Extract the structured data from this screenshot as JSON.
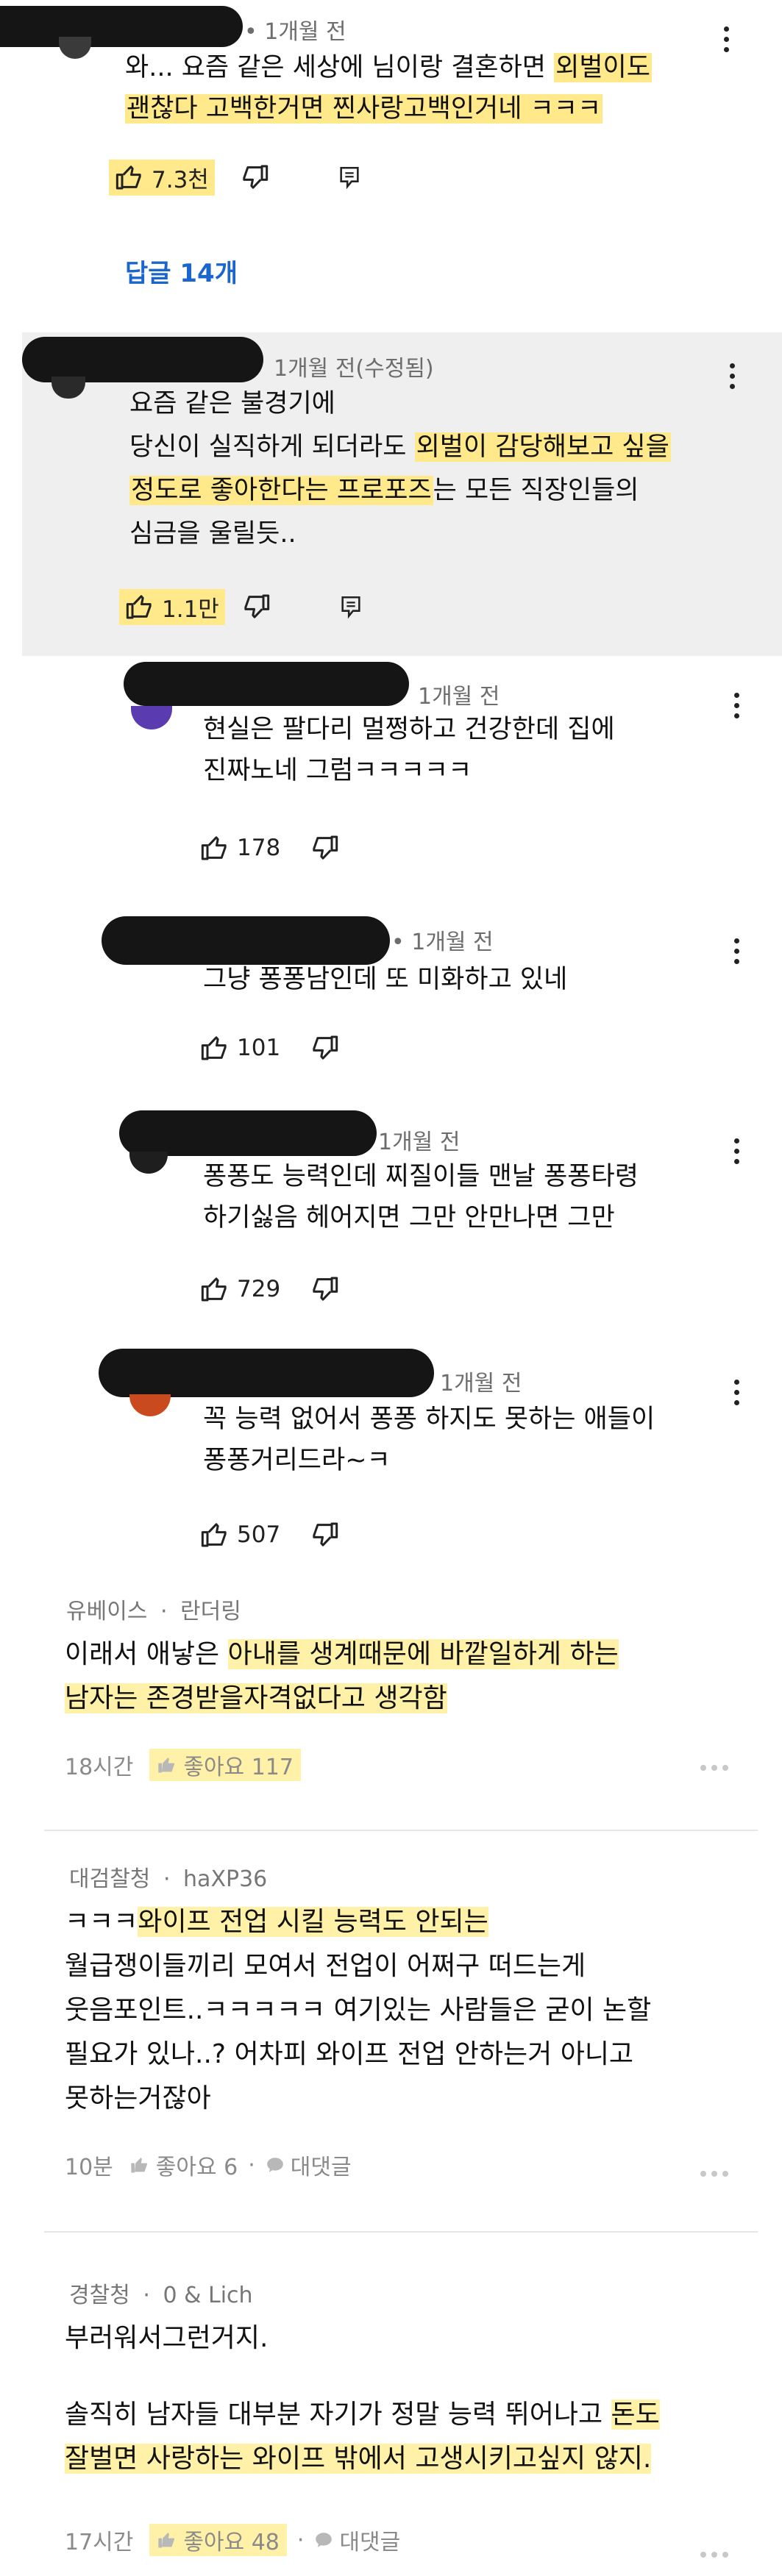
{
  "youtube": {
    "c1": {
      "time": "• 1개월 전",
      "line1_pre": "와... 요즘 같은 세상에 님이랑 결혼하면 ",
      "line1_hl": "외벌이도",
      "line2": "괜찮다 고백한거면 찐사랑고백인거네 ㅋㅋㅋ",
      "likes": "7.3천",
      "replies": "답글 14개"
    },
    "c2": {
      "time": "1개월 전(수정됨)",
      "line1": "요즘 같은 불경기에",
      "line2_pre": "당신이 실직하게 되더라도 ",
      "line2_hl": "외벌이 감당해보고 싶을",
      "line3_hl": "정도로 좋아한다는 프로포즈",
      "line3_post": "는 모든 직장인들의",
      "line4": "심금을 울릴듯..",
      "likes": "1.1만"
    },
    "r1": {
      "time": "1개월 전",
      "line1": "현실은 팔다리 멀쩡하고 건강한데 집에",
      "line2": "진짜노네 그럼ㅋㅋㅋㅋㅋ",
      "likes": "178"
    },
    "r2": {
      "time": "• 1개월 전",
      "line1": "그냥 퐁퐁남인데 또 미화하고 있네",
      "likes": "101"
    },
    "r3": {
      "time": "1개월 전",
      "line1": "퐁퐁도 능력인데 찌질이들 맨날 퐁퐁타령",
      "line2": "하기싫음 헤어지면 그만 안만나면 그만",
      "likes": "729"
    },
    "r4": {
      "time": "1개월 전",
      "line1": "꼭 능력 없어서 퐁퐁 하지도 못하는 애들이",
      "line2": "퐁퐁거리드라~ㅋ",
      "likes": "507"
    }
  },
  "naver": {
    "n1": {
      "company": "유베이스",
      "sep": "·",
      "nick": "란더링",
      "line1_pre": "이래서 애낳은 ",
      "line1_hl": "아내를 생계때문에 바깥일하게 하는",
      "line2_hl": "남자는 존경받을자격없다고 ",
      "line2_post": "생각함",
      "time": "18시간",
      "like": "좋아요 117"
    },
    "n2": {
      "company": "대검찰청",
      "sep": "·",
      "nick": "haXP36",
      "line1_pre": "ㅋㅋㅋ",
      "line1_hl": "와이프 전업 시킬 능력도 안되는",
      "line2": "월급쟁이들끼리 모여서 전업이 어쩌구 떠드는게",
      "line3": "웃음포인트..ㅋㅋㅋㅋㅋ 여기있는 사람들은 굳이 논할",
      "line4": "필요가 있나..? 어차피 와이프 전업 안하는거 아니고",
      "line5": "못하는거잖아",
      "time": "10분",
      "like": "좋아요 6",
      "reply": "대댓글"
    },
    "n3": {
      "company": "경찰청",
      "sep": "·",
      "nick": "0 & Lich",
      "line1": "부러워서그런거지.",
      "line2_pre": "솔직히 남자들 대부분 자기가 정말 능력 뛰어나고 ",
      "line2_hl": "돈도",
      "line3_hl": "잘벌면 사랑하는 와이프 밖에서 고생시키고싶지 않지.",
      "time": "17시간",
      "like": "좋아요 48",
      "reply": "대댓글"
    }
  }
}
